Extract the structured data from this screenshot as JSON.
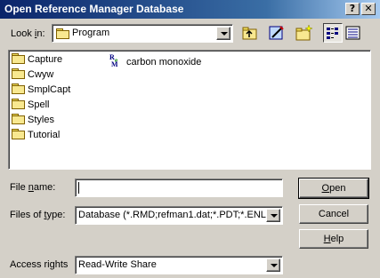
{
  "window": {
    "title": "Open Reference Manager Database",
    "help_btn": "?",
    "close_btn": "✕"
  },
  "look_in": {
    "label_pre": "Look ",
    "label_ul": "i",
    "label_post": "n:",
    "value": "Program"
  },
  "files": {
    "folders": [
      "Capture",
      "Cwyw",
      "SmplCapt",
      "Spell",
      "Styles",
      "Tutorial"
    ],
    "database": "carbon monoxide"
  },
  "filename": {
    "label_pre": "File ",
    "label_ul": "n",
    "label_post": "ame:",
    "value": ""
  },
  "filetype": {
    "label_pre": "Files of ",
    "label_ul": "t",
    "label_post": "ype:",
    "value": "Database (*.RMD;refman1.dat;*.PDT;*.ENL)"
  },
  "access": {
    "label": "Access rights",
    "value": "Read-Write Share"
  },
  "buttons": {
    "open_ul": "O",
    "open_rest": "pen",
    "cancel": "Cancel",
    "help_ul": "H",
    "help_rest": "elp"
  }
}
